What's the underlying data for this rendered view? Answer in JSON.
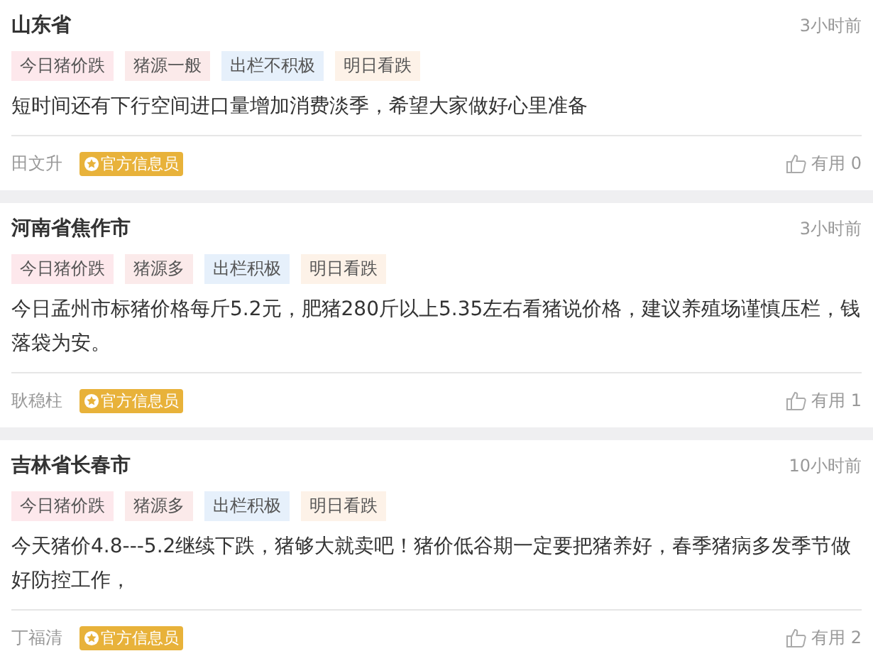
{
  "posts": [
    {
      "location": "山东省",
      "time": "3小时前",
      "tags": [
        {
          "label": "今日猪价跌",
          "color": "#fde8ec"
        },
        {
          "label": "猪源一般",
          "color": "#fbeaea"
        },
        {
          "label": "出栏不积极",
          "color": "#e6f0fb"
        },
        {
          "label": "明日看跌",
          "color": "#fdf2e8"
        }
      ],
      "text": "短时间还有下行空间进口量增加消费淡季，希望大家做好心里准备",
      "author": "田文升",
      "badge": "官方信息员",
      "useful": "有用 0"
    },
    {
      "location": "河南省焦作市",
      "time": "3小时前",
      "tags": [
        {
          "label": "今日猪价跌",
          "color": "#fde8ec"
        },
        {
          "label": "猪源多",
          "color": "#fbeaea"
        },
        {
          "label": "出栏积极",
          "color": "#e6f0fb"
        },
        {
          "label": "明日看跌",
          "color": "#fdf2e8"
        }
      ],
      "text": "今日孟州市标猪价格每斤5.2元，肥猪280斤以上5.35左右看猪说价格，建议养殖场谨慎压栏，钱落袋为安。",
      "author": "耿稳柱",
      "badge": "官方信息员",
      "useful": "有用 1"
    },
    {
      "location": "吉林省长春市",
      "time": "10小时前",
      "tags": [
        {
          "label": "今日猪价跌",
          "color": "#fde8ec"
        },
        {
          "label": "猪源多",
          "color": "#fbeaea"
        },
        {
          "label": "出栏积极",
          "color": "#e6f0fb"
        },
        {
          "label": "明日看跌",
          "color": "#fdf2e8"
        }
      ],
      "text": "今天猪价4.8---5.2继续下跌，猪够大就卖吧！猪价低谷期一定要把猪养好，春季猪病多发季节做好防控工作，",
      "author": "丁福清",
      "badge": "官方信息员",
      "useful": "有用 2"
    }
  ]
}
